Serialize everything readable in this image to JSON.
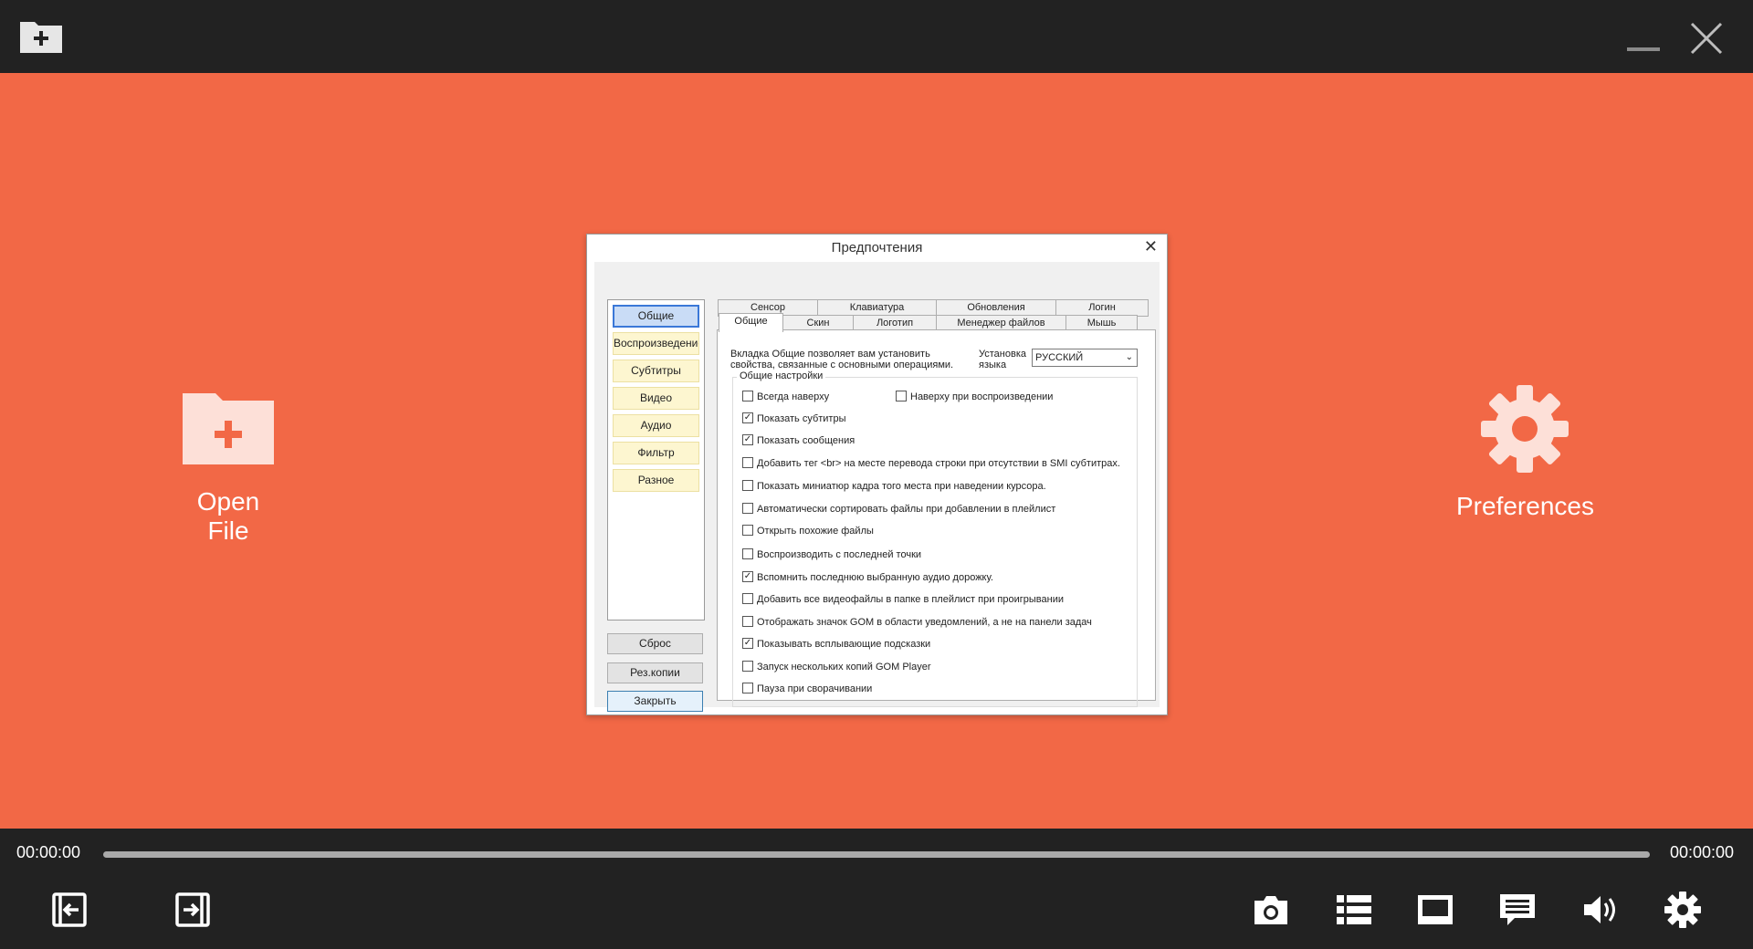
{
  "main": {
    "open_file_label": "Open File",
    "preferences_label": "Preferences"
  },
  "dialog": {
    "title": "Предпочтения",
    "sidebar": [
      {
        "label": "Общие",
        "selected": true
      },
      {
        "label": "Воспроизведение",
        "selected": false
      },
      {
        "label": "Субтитры",
        "selected": false
      },
      {
        "label": "Видео",
        "selected": false
      },
      {
        "label": "Аудио",
        "selected": false
      },
      {
        "label": "Фильтр",
        "selected": false
      },
      {
        "label": "Разное",
        "selected": false
      }
    ],
    "buttons": {
      "reset": "Сброс",
      "backup": "Рез.копии",
      "close": "Закрыть"
    },
    "tabs_top": [
      "Сенсор",
      "Клавиатура",
      "Обновления",
      "Логин"
    ],
    "tabs_bottom": [
      "Общие",
      "Скин",
      "Логотип",
      "Менеджер файлов",
      "Мышь"
    ],
    "description": "Вкладка Общие позволяет вам установить свойства, связанные с основными операциями.",
    "language_label": "Установка языка",
    "language_value": "РУССКИЙ",
    "group_title": "Общие настройки",
    "options": [
      {
        "label": "Всегда наверху",
        "checked": false
      },
      {
        "label": "Наверху при воспроизведении",
        "checked": false
      },
      {
        "label": "Показать субтитры",
        "checked": true
      },
      {
        "label": "Показать сообщения",
        "checked": true
      },
      {
        "label": "Добавить тег <br> на месте перевода строки при отсутствии в SMI субтитрах.",
        "checked": false
      },
      {
        "label": "Показать миниатюр кадра того места при наведении курсора.",
        "checked": false
      },
      {
        "label": "Автоматически сортировать файлы при добавлении в плейлист",
        "checked": false
      },
      {
        "label": "Открыть похожие файлы",
        "checked": false
      },
      {
        "label": "Воспроизводить с последней точки",
        "checked": false
      },
      {
        "label": "Вспомнить последнюю выбранную аудио дорожку.",
        "checked": true
      },
      {
        "label": "Добавить все видеофайлы в папке в плейлист при проигрывании",
        "checked": false
      },
      {
        "label": "Отображать значок GOM в области уведомлений, а не на панели задач",
        "checked": false
      },
      {
        "label": "Показывать всплывающие подсказки",
        "checked": true
      },
      {
        "label": "Запуск нескольких копий GOM Player",
        "checked": false
      },
      {
        "label": "Пауза при сворачивании",
        "checked": false
      }
    ]
  },
  "player": {
    "time_current": "00:00:00",
    "time_total": "00:00:00",
    "progress": 0
  },
  "icons": {
    "topbar": [
      "open-folder-icon",
      "minimize-icon",
      "close-icon"
    ],
    "controls": [
      "exit-left-icon",
      "exit-right-icon",
      "camera-icon",
      "playlist-icon",
      "screen-icon",
      "subtitles-icon",
      "volume-icon",
      "gear-icon"
    ]
  },
  "colors": {
    "background": "#f26846",
    "bars": "#222222",
    "icon_light": "#ffe0d6"
  }
}
